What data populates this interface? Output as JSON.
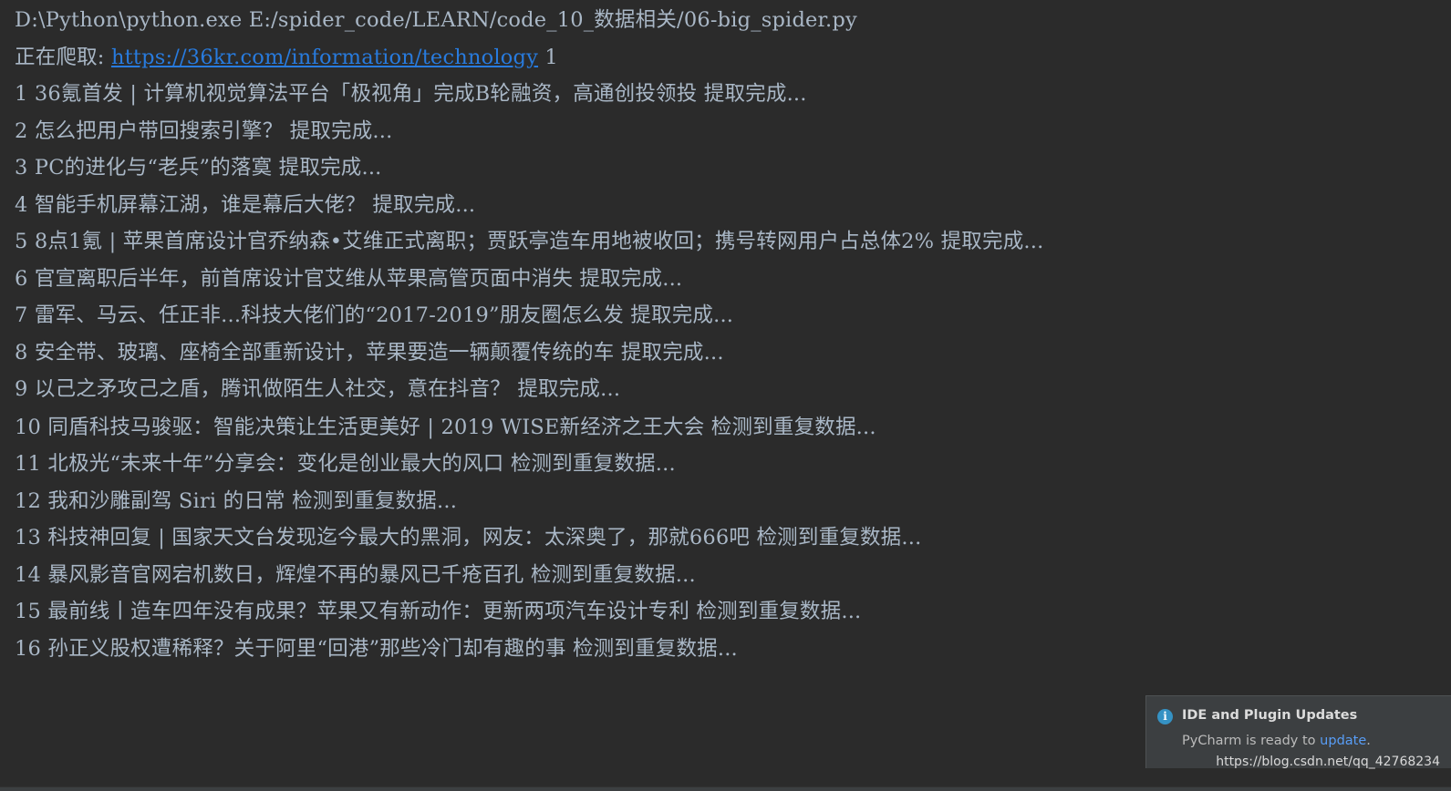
{
  "console": {
    "command": "D:\\Python\\python.exe E:/spider_code/LEARN/code_10_数据相关/06-big_spider.py",
    "crawling_prefix": "正在爬取: ",
    "crawling_url": "https://36kr.com/information/technology",
    "crawling_suffix": " 1",
    "lines": [
      "1 36氪首发 | 计算机视觉算法平台「极视角」完成B轮融资，高通创投领投 提取完成...",
      "2 怎么把用户带回搜索引擎？ 提取完成...",
      "3 PC的进化与“老兵”的落寞 提取完成...",
      "4 智能手机屏幕江湖，谁是幕后大佬？ 提取完成...",
      "5 8点1氪 | 苹果首席设计官乔纳森•艾维正式离职；贾跃亭造车用地被收回；携号转网用户占总体2% 提取完成...",
      "6 官宣离职后半年，前首席设计官艾维从苹果高管页面中消失 提取完成...",
      "7 雷军、马云、任正非...科技大佬们的“2017-2019”朋友圈怎么发 提取完成...",
      "8 安全带、玻璃、座椅全部重新设计，苹果要造一辆颠覆传统的车 提取完成...",
      "9 以己之矛攻己之盾，腾讯做陌生人社交，意在抖音？ 提取完成...",
      "10 同盾科技马骏驱：智能决策让生活更美好 | 2019 WISE新经济之王大会 检测到重复数据...",
      "11 北极光“未来十年”分享会：变化是创业最大的风口 检测到重复数据...",
      "12 我和沙雕副驾 Siri 的日常 检测到重复数据...",
      "13 科技神回复 | 国家天文台发现迄今最大的黑洞，网友：太深奥了，那就666吧 检测到重复数据...",
      "14 暴风影音官网宕机数日，辉煌不再的暴风已千疮百孔 检测到重复数据...",
      "15 最前线丨造车四年没有成果？苹果又有新动作：更新两项汽车设计专利 检测到重复数据...",
      "16 孙正义股权遭稀释？关于阿里“回港”那些冷门却有趣的事 检测到重复数据..."
    ]
  },
  "notification": {
    "icon": "info-icon",
    "icon_glyph": "i",
    "title": "IDE and Plugin Updates",
    "body_prefix": "PyCharm is ready to ",
    "body_link": "update",
    "body_suffix": "."
  },
  "watermark": "https://blog.csdn.net/qq_42768234",
  "colors": {
    "background": "#2b2b2b",
    "text": "#a9b7c6",
    "link": "#287bde",
    "notification_bg": "#3c3f41",
    "info_icon": "#3592c4"
  }
}
